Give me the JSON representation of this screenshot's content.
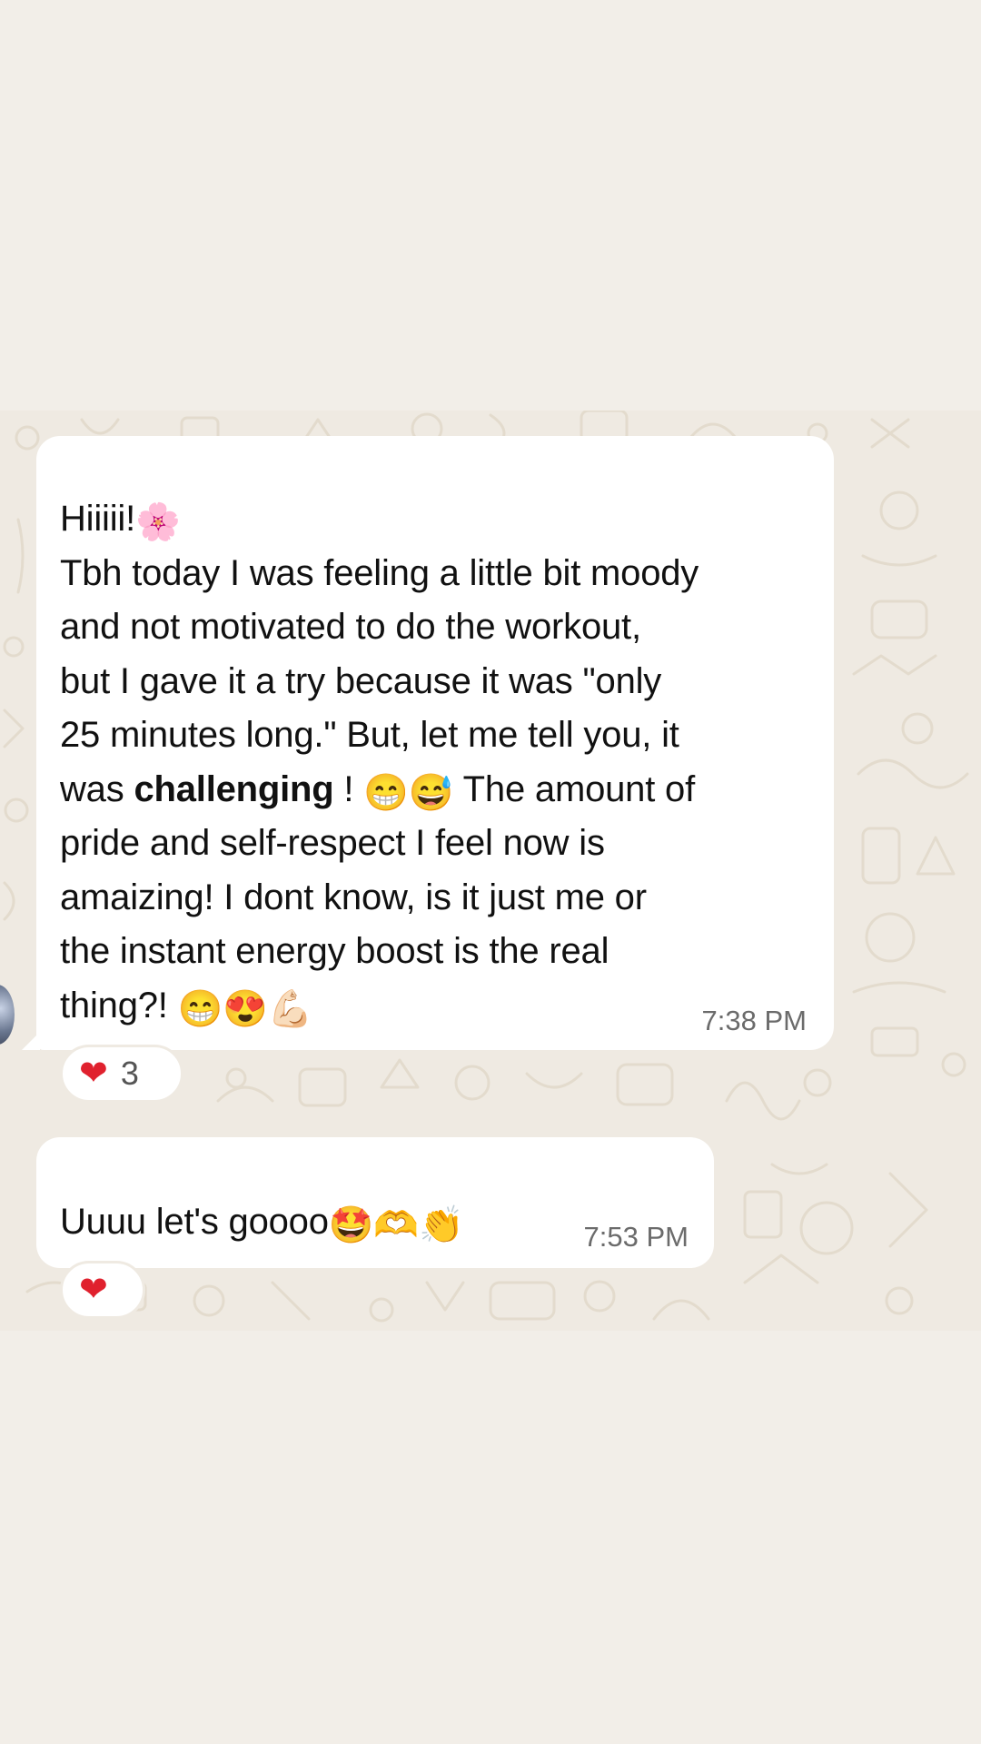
{
  "messages": [
    {
      "lines": [
        {
          "text": "Hiiiii!",
          "emoji": "🌸"
        },
        {
          "text": "Tbh today I was feeling a little bit moody"
        },
        {
          "text": "and not motivated to do the workout,"
        },
        {
          "text": "but I gave it a try because it was \"only"
        },
        {
          "text": "25 minutes long.\" But, let me tell you, it"
        },
        {
          "pre": "was ",
          "bold": "challenging",
          "post": " ! ",
          "emoji": "😁😅",
          "tail": " The amount of"
        },
        {
          "text": "pride and self-respect I feel now is"
        },
        {
          "text": "amaizing! I dont know, is it just me or"
        },
        {
          "text": "the instant energy boost is the real"
        },
        {
          "text": "thing?! ",
          "emoji": "😁😍💪🏻"
        }
      ],
      "time": "7:38 PM",
      "reaction": {
        "icon": "heart-icon",
        "count": "3"
      }
    },
    {
      "lines": [
        {
          "text": "Uuuu let's goooo",
          "emoji": "🤩🫶👏"
        }
      ],
      "time": "7:53 PM",
      "reaction": {
        "icon": "heart-icon"
      }
    }
  ],
  "colors": {
    "page_background": "#f2eee8",
    "chat_background": "#efeae2",
    "bubble": "#ffffff",
    "heart": "#e0212e"
  }
}
